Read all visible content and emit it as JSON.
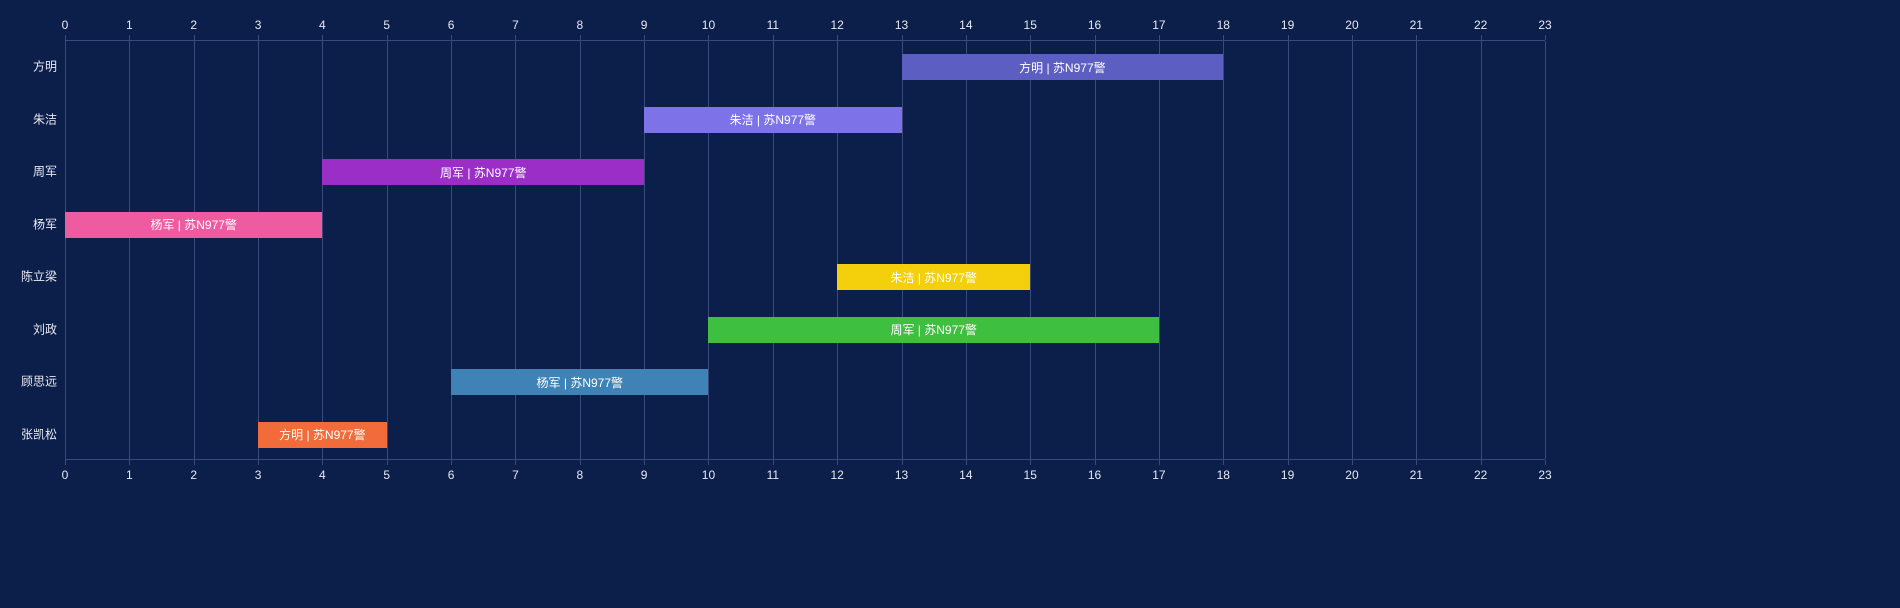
{
  "chart_data": {
    "type": "bar",
    "orientation": "horizontal_range",
    "xlabel": "",
    "ylabel": "",
    "xlim": [
      0,
      23
    ],
    "x_ticks": [
      0,
      1,
      2,
      3,
      4,
      5,
      6,
      7,
      8,
      9,
      10,
      11,
      12,
      13,
      14,
      15,
      16,
      17,
      18,
      19,
      20,
      21,
      22,
      23
    ],
    "categories": [
      "方明",
      "朱洁",
      "周军",
      "杨军",
      "陈立梁",
      "刘政",
      "顾思远",
      "张凯松"
    ],
    "series": [
      {
        "row": "方明",
        "start": 13,
        "end": 18,
        "label": "方明 | 苏N977警",
        "color": "#5d5ec2"
      },
      {
        "row": "朱洁",
        "start": 9,
        "end": 13,
        "label": "朱洁 | 苏N977警",
        "color": "#7d72e8"
      },
      {
        "row": "周军",
        "start": 4,
        "end": 9,
        "label": "周军 | 苏N977警",
        "color": "#9b2ec7"
      },
      {
        "row": "杨军",
        "start": 0,
        "end": 4,
        "label": "杨军 | 苏N977警",
        "color": "#ef5ba1"
      },
      {
        "row": "陈立梁",
        "start": 12,
        "end": 15,
        "label": "朱洁 | 苏N977警",
        "color": "#f4cf0b"
      },
      {
        "row": "刘政",
        "start": 10,
        "end": 17,
        "label": "周军 | 苏N977警",
        "color": "#3fbf3f"
      },
      {
        "row": "顾思远",
        "start": 6,
        "end": 10,
        "label": "杨军 | 苏N977警",
        "color": "#3f82b5"
      },
      {
        "row": "张凯松",
        "start": 3,
        "end": 5,
        "label": "方明 | 苏N977警",
        "color": "#f26b3a"
      }
    ]
  }
}
